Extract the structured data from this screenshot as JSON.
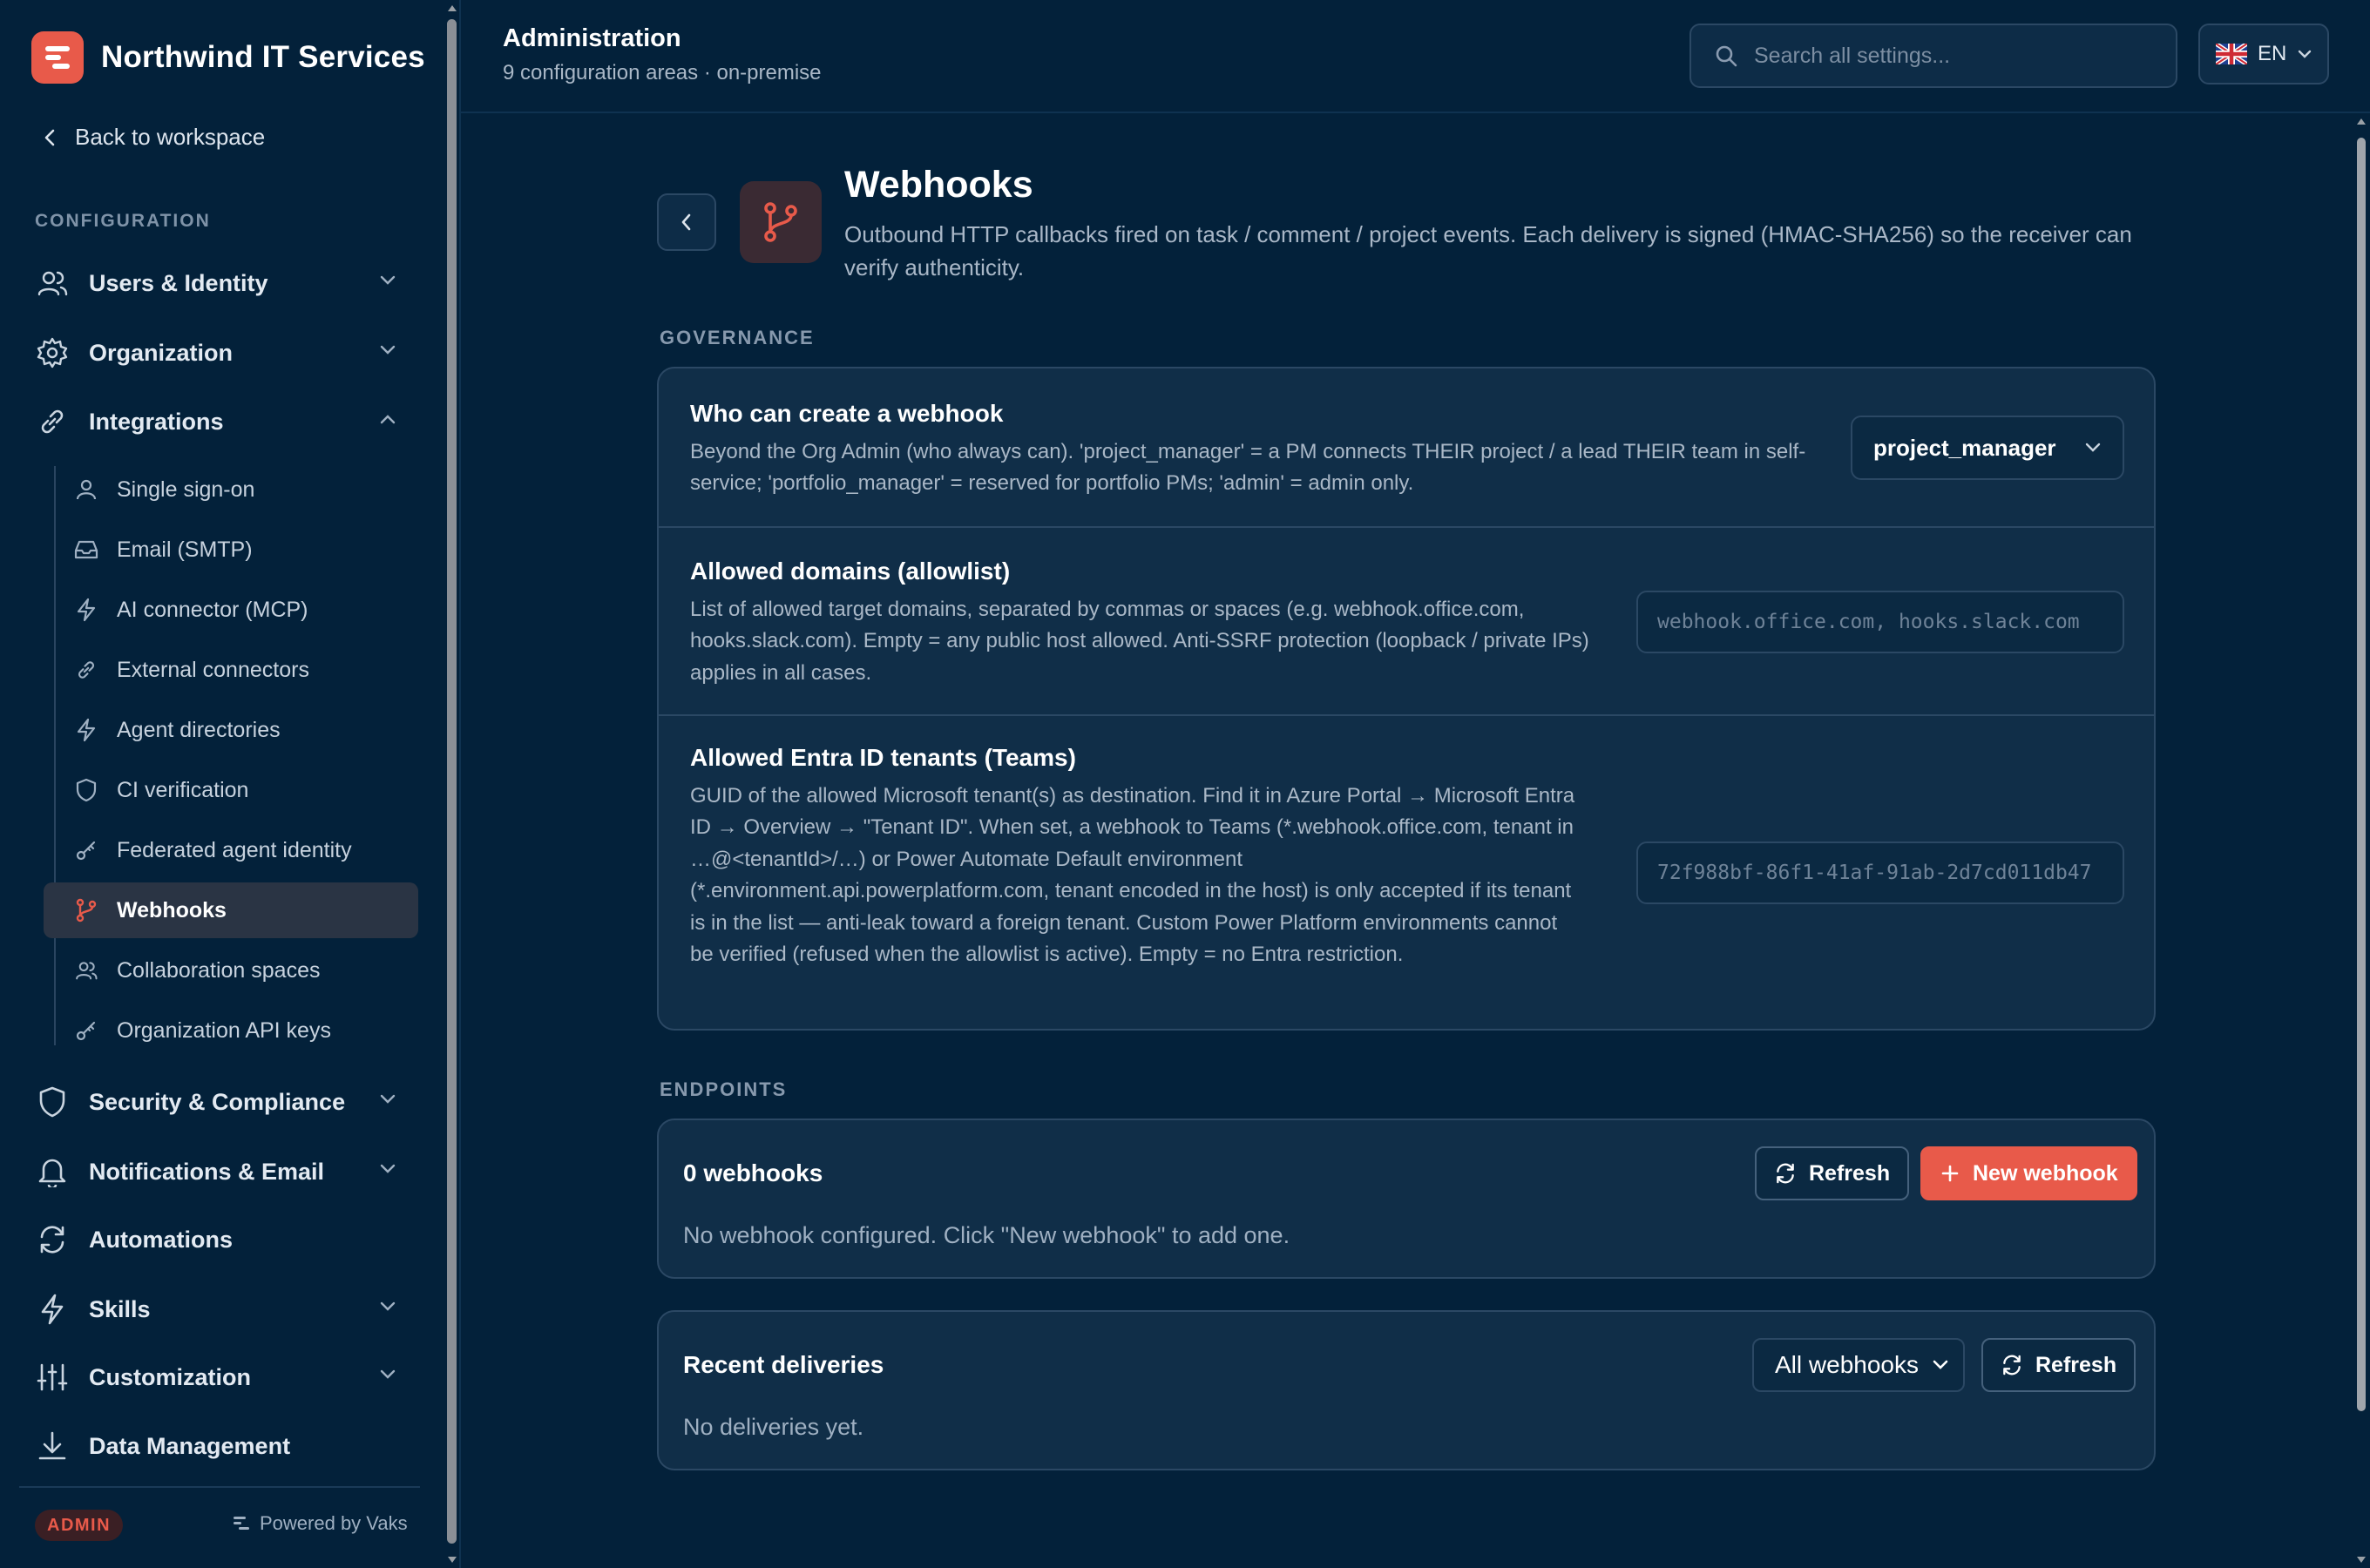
{
  "app": {
    "brand_name": "Northwind IT Services",
    "back_label": "Back to workspace",
    "section_label": "CONFIGURATION",
    "admin_badge": "ADMIN",
    "powered_by": "Powered by Vaks"
  },
  "sidebar": {
    "groups": [
      {
        "label": "Users & Identity",
        "icon": "users-icon",
        "expanded": false
      },
      {
        "label": "Organization",
        "icon": "gear-icon",
        "expanded": false
      },
      {
        "label": "Integrations",
        "icon": "link-icon",
        "expanded": true
      },
      {
        "label": "Security & Compliance",
        "icon": "shield-icon",
        "expanded": false
      },
      {
        "label": "Notifications & Email",
        "icon": "bell-icon",
        "expanded": false
      },
      {
        "label": "Automations",
        "icon": "refresh-icon"
      },
      {
        "label": "Skills",
        "icon": "bolt-icon",
        "expanded": false
      },
      {
        "label": "Customization",
        "icon": "sliders-icon",
        "expanded": false
      },
      {
        "label": "Data Management",
        "icon": "download-icon"
      }
    ],
    "integrations_items": [
      {
        "label": "Single sign-on",
        "icon": "user-icon"
      },
      {
        "label": "Email (SMTP)",
        "icon": "inbox-icon"
      },
      {
        "label": "AI connector (MCP)",
        "icon": "bolt-icon"
      },
      {
        "label": "External connectors",
        "icon": "link-icon"
      },
      {
        "label": "Agent directories",
        "icon": "bolt-icon"
      },
      {
        "label": "CI verification",
        "icon": "shield-icon"
      },
      {
        "label": "Federated agent identity",
        "icon": "key-icon"
      },
      {
        "label": "Webhooks",
        "icon": "git-branch-icon",
        "active": true
      },
      {
        "label": "Collaboration spaces",
        "icon": "users-icon"
      },
      {
        "label": "Organization API keys",
        "icon": "key-icon"
      }
    ]
  },
  "topbar": {
    "title": "Administration",
    "subtitle": "9 configuration areas · on-premise",
    "search_placeholder": "Search all settings...",
    "language": "EN"
  },
  "page": {
    "title": "Webhooks",
    "description": "Outbound HTTP callbacks fired on task / comment / project events. Each delivery is signed (HMAC-SHA256) so the receiver can verify authenticity."
  },
  "governance": {
    "label": "GOVERNANCE",
    "who_can_create": {
      "title": "Who can create a webhook",
      "description": "Beyond the Org Admin (who always can). 'project_manager' = a PM connects THEIR project / a lead THEIR team in self-service; 'portfolio_manager' = reserved for portfolio PMs; 'admin' = admin only.",
      "value": "project_manager"
    },
    "allowed_domains": {
      "title": "Allowed domains (allowlist)",
      "description": "List of allowed target domains, separated by commas or spaces (e.g. webhook.office.com, hooks.slack.com). Empty = any public host allowed. Anti-SSRF protection (loopback / private IPs) applies in all cases.",
      "placeholder": "webhook.office.com, hooks.slack.com"
    },
    "allowed_tenants": {
      "title": "Allowed Entra ID tenants (Teams)",
      "description": "GUID of the allowed Microsoft tenant(s) as destination. Find it in Azure Portal → Microsoft Entra ID → Overview → \"Tenant ID\". When set, a webhook to Teams (*.webhook.office.com, tenant in …@<tenantId>/…) or Power Automate Default environment (*.environment.api.powerplatform.com, tenant encoded in the host) is only accepted if its tenant is in the list — anti-leak toward a foreign tenant. Custom Power Platform environments cannot be verified (refused when the allowlist is active). Empty = no Entra restriction.",
      "placeholder": "72f988bf-86f1-41af-91ab-2d7cd011db47"
    }
  },
  "endpoints": {
    "label": "ENDPOINTS",
    "count_label": "0 webhooks",
    "refresh_label": "Refresh",
    "new_label": "New webhook",
    "empty_text": "No webhook configured. Click \"New webhook\" to add one."
  },
  "deliveries": {
    "title": "Recent deliveries",
    "filter_value": "All webhooks",
    "refresh_label": "Refresh",
    "empty_text": "No deliveries yet."
  },
  "colors": {
    "accent": "#e85a4a",
    "background": "#03213a",
    "card": "#102e48",
    "border": "#2b4864"
  }
}
